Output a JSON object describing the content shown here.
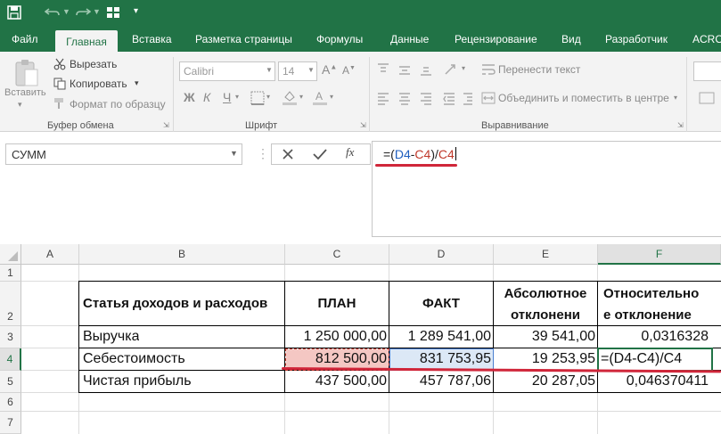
{
  "ribbon_tabs": {
    "file": "Файл",
    "home": "Главная",
    "insert": "Вставка",
    "layout": "Разметка страницы",
    "formulas": "Формулы",
    "data": "Данные",
    "review": "Рецензирование",
    "view": "Вид",
    "developer": "Разработчик",
    "acro": "ACRO"
  },
  "clipboard": {
    "paste": "Вставить",
    "cut": "Вырезать",
    "copy": "Копировать",
    "format_painter": "Формат по образцу",
    "group": "Буфер обмена"
  },
  "font": {
    "name": "Calibri",
    "size": "14",
    "bold": "Ж",
    "italic": "К",
    "underline": "Ч",
    "group": "Шрифт"
  },
  "alignment": {
    "wrap": "Перенести текст",
    "merge": "Объединить и поместить в центре",
    "group": "Выравнивание"
  },
  "formula_bar": {
    "name_box": "СУММ",
    "fx": "fx",
    "f_eq": "=(",
    "f_d4": "D4",
    "f_minus": "-",
    "f_c4a": "C4",
    "f_div": ")/",
    "f_c4b": "C4"
  },
  "columns": [
    "A",
    "B",
    "C",
    "D",
    "E",
    "F"
  ],
  "rows": [
    "1",
    "2",
    "3",
    "4",
    "5",
    "6",
    "7"
  ],
  "table": {
    "headers": {
      "b": "Статья доходов и расходов",
      "c": "ПЛАН",
      "d": "ФАКТ",
      "e1": "Абсолютное",
      "e2": "отклонени",
      "f1": "Относительно",
      "f2": "е отклонение"
    },
    "rows": [
      {
        "b": "Выручка",
        "c": "1 250 000,00",
        "d": "1 289 541,00",
        "e": "39 541,00",
        "f": "0,0316328"
      },
      {
        "b": "Себестоимость",
        "c": "812 500,00",
        "d": "831 753,95",
        "e": "19 253,95",
        "f": "=(D4-C4)/C4"
      },
      {
        "b": "Чистая прибыль",
        "c": "437 500,00",
        "d": "457 787,06",
        "e": "20 287,05",
        "f": "0,046370411"
      }
    ]
  },
  "colors": {
    "excel_green": "#217346",
    "highlight_red": "#d0263a",
    "c4_fill": "#f4c7c3",
    "d4_fill": "#dce8f6"
  }
}
